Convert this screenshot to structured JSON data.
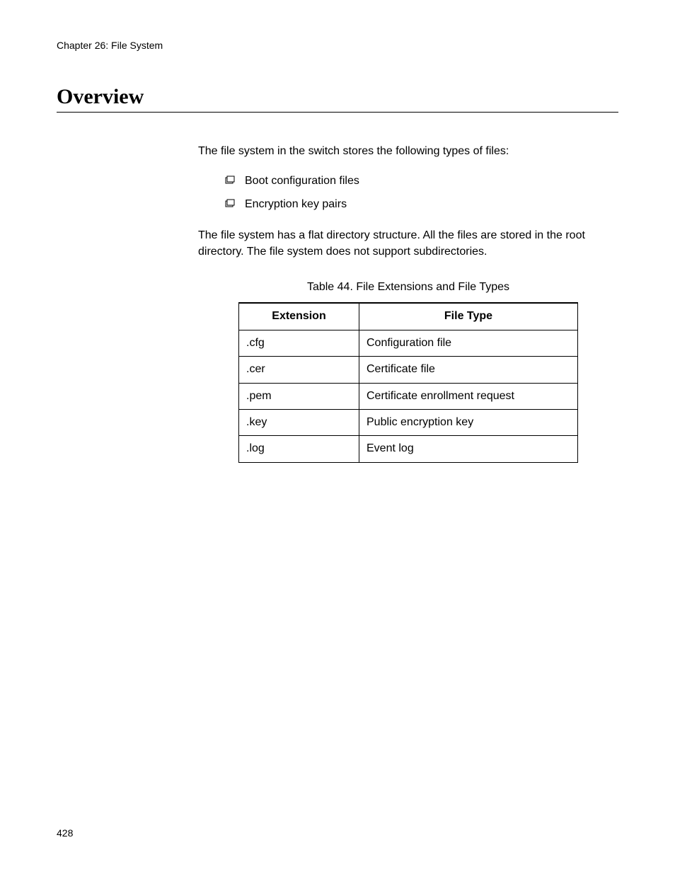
{
  "header": {
    "chapter": "Chapter 26: File System"
  },
  "section": {
    "title": "Overview"
  },
  "content": {
    "intro": "The file system in the switch stores the following types of files:",
    "bullets": [
      "Boot configuration files",
      "Encryption key pairs"
    ],
    "paragraph": "The file system has a flat directory structure. All the files are stored in the root directory. The file system does not support subdirectories.",
    "table_caption": "Table 44. File Extensions and File Types",
    "table": {
      "headers": [
        "Extension",
        "File Type"
      ],
      "rows": [
        [
          ".cfg",
          "Configuration file"
        ],
        [
          ".cer",
          "Certificate file"
        ],
        [
          ".pem",
          "Certificate enrollment request"
        ],
        [
          ".key",
          "Public encryption key"
        ],
        [
          ".log",
          "Event log"
        ]
      ]
    }
  },
  "footer": {
    "page_number": "428"
  }
}
